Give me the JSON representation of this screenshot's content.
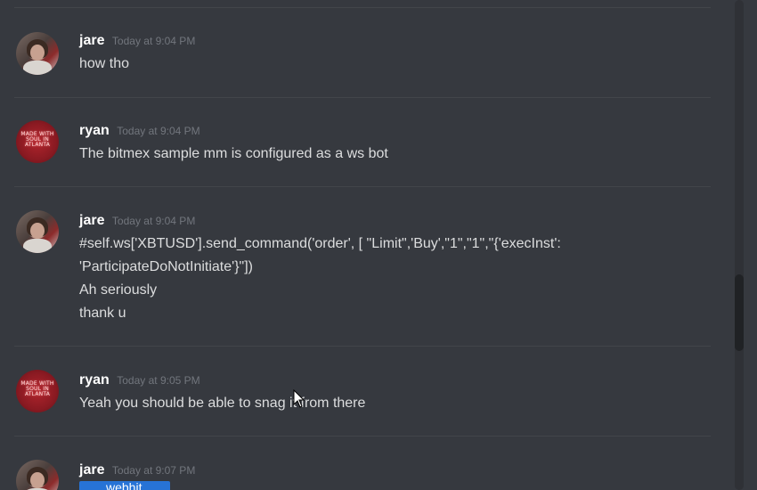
{
  "messages": [
    {
      "user": "jare",
      "time": "Today at 9:04 PM",
      "avatar": "jare-avatar",
      "lines": [
        "how tho"
      ]
    },
    {
      "user": "ryan",
      "time": "Today at 9:04 PM",
      "avatar": "ryan-avatar",
      "avatar_text": "MADE WITH SOUL IN ATLANTA",
      "lines": [
        "The bitmex sample mm is configured as a ws bot"
      ]
    },
    {
      "user": "jare",
      "time": "Today at 9:04 PM",
      "avatar": "jare-avatar",
      "lines": [
        "#self.ws['XBTUSD'].send_command('order', [ \"Limit\",'Buy',\"1\",\"1\",\"{'execInst':",
        "'ParticipateDoNotInitiate'}\"])",
        "Ah seriously",
        "thank u"
      ]
    },
    {
      "user": "ryan",
      "time": "Today at 9:05 PM",
      "avatar": "ryan-avatar",
      "avatar_text": "MADE WITH SOUL IN ATLANTA",
      "lines": [
        "Yeah you should be able to snag it from there"
      ]
    },
    {
      "user": "jare",
      "time": "Today at 9:07 PM",
      "avatar": "jare-avatar",
      "lines": [],
      "preview_text": "webhit"
    }
  ],
  "colors": {
    "background": "#36393f",
    "username": "#ffffff",
    "timestamp": "#72767d",
    "message_text": "#dcddde",
    "divider": "#42454a",
    "link_preview": "#2773d6"
  },
  "icons": {
    "cursor": "mouse-pointer-icon"
  }
}
